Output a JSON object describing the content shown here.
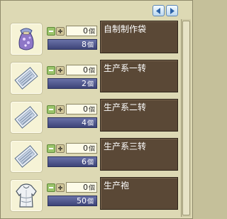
{
  "nav": {
    "prev_icon": "triangle-left-icon",
    "next_icon": "triangle-right-icon"
  },
  "unit_qty": "個",
  "unit_stock": "個",
  "items": [
    {
      "name": "自制制作袋",
      "qty": "0",
      "stock": "8",
      "icon": "pouch-icon"
    },
    {
      "name": "生产系一转",
      "qty": "0",
      "stock": "2",
      "icon": "recipe-scroll-icon"
    },
    {
      "name": "生产系二转",
      "qty": "0",
      "stock": "4",
      "icon": "recipe-scroll-icon"
    },
    {
      "name": "生产系三转",
      "qty": "0",
      "stock": "6",
      "icon": "recipe-scroll-icon"
    },
    {
      "name": "生产袍",
      "qty": "0",
      "stock": "50",
      "icon": "robe-icon"
    }
  ],
  "colors": {
    "panel": "#ddd9b4",
    "name_box": "#5a4836",
    "stock_bar": "#4b528a",
    "accent_blue": "#5d87b6"
  }
}
